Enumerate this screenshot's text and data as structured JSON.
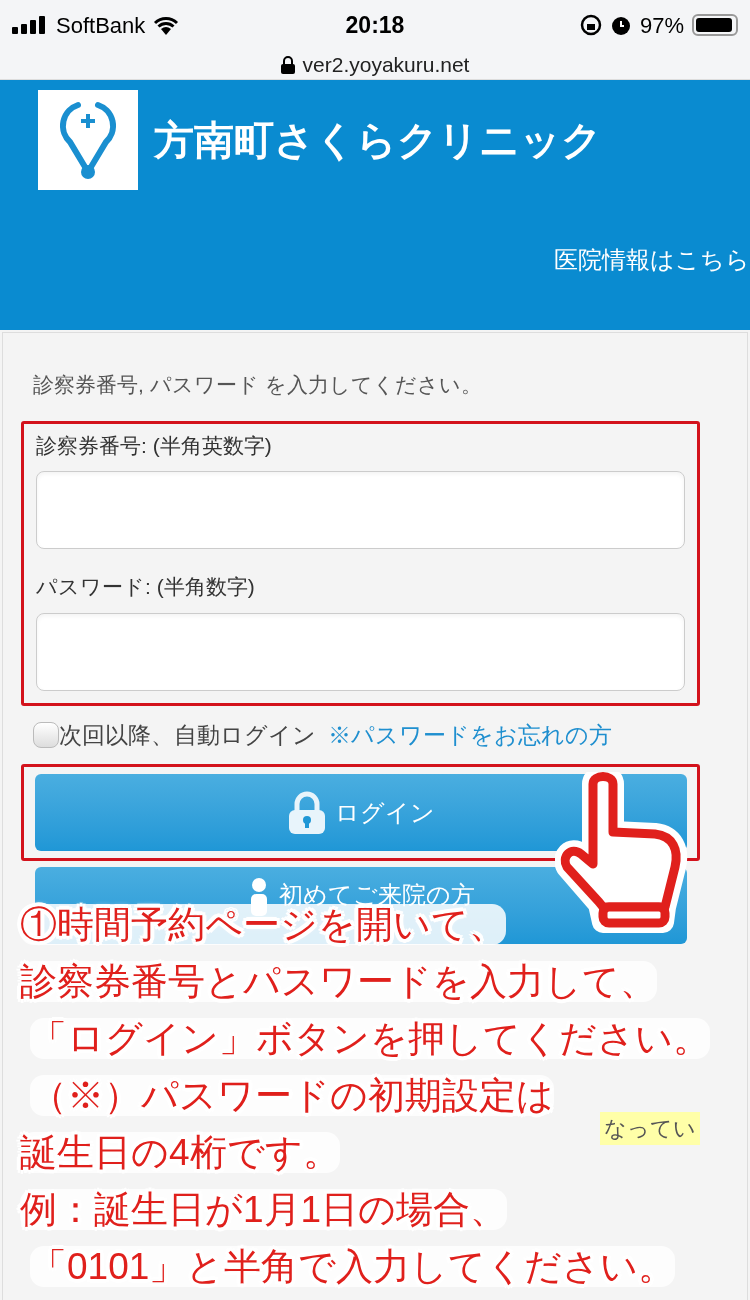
{
  "status_bar": {
    "carrier": "SoftBank",
    "time": "20:18",
    "battery": "97%"
  },
  "url_bar": {
    "url": "ver2.yoyakuru.net"
  },
  "header": {
    "clinic_name": "方南町さくらクリニック",
    "info_link": "医院情報はこちら"
  },
  "form": {
    "instruction": "診察券番号, パスワード を入力してください。",
    "fields": [
      {
        "label": "診察券番号: (半角英数字)"
      },
      {
        "label": "パスワード: (半角数字)"
      }
    ],
    "auto_login": {
      "label": "次回以降、自動ログイン",
      "checked": false
    },
    "forgot_link": "※パスワードをお忘れの方",
    "buttons": [
      {
        "kind": "login",
        "label": "ログイン"
      },
      {
        "kind": "first_visit",
        "label": "初めてご来院の方"
      }
    ],
    "highlight_fragment": "なってい"
  },
  "annotation": {
    "lines": [
      "①時間予約ページを開いて、",
      "診察券番号とパスワードを入力して、",
      "「ログイン」ボタンを押してください。",
      "（※）パスワードの初期設定は",
      "誕生日の4桁です。",
      "例：誕生日が1月1日の場合、",
      "「0101」と半角で入力してください。"
    ]
  }
}
